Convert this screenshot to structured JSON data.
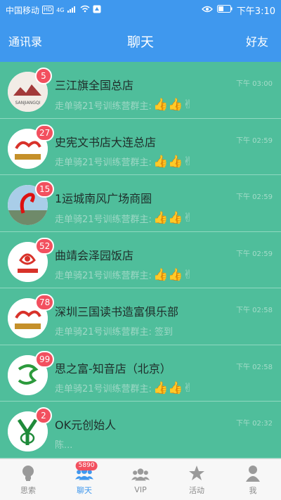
{
  "status": {
    "carrier": "中国移动",
    "hd": "HD",
    "network": "4G",
    "time": "下午3:10"
  },
  "nav": {
    "left": "通讯录",
    "title": "聊天",
    "right": "好友"
  },
  "chats": [
    {
      "name": "三江旗全国总店",
      "badge": "5",
      "time": "下午 03:00",
      "preview": "走单骑21号训练营群主:",
      "emoji": "👍👍✌"
    },
    {
      "name": "史宪文书店大连总店",
      "badge": "27",
      "time": "下午 02:59",
      "preview": "走单骑21号训练营群主:",
      "emoji": "👍👍✌"
    },
    {
      "name": "1运城南风广场商圈",
      "badge": "15",
      "time": "下午 02:59",
      "preview": "走单骑21号训练营群主:",
      "emoji": "👍👍✌"
    },
    {
      "name": "曲靖会泽园饭店",
      "badge": "52",
      "time": "下午 02:59",
      "preview": "走单骑21号训练营群主:",
      "emoji": "👍👍✌"
    },
    {
      "name": "深圳三国读书造富俱乐部",
      "badge": "78",
      "time": "下午 02:58",
      "preview": "走单骑21号训练营群主: 签到",
      "emoji": ""
    },
    {
      "name": "思之富-知音店（北京）",
      "badge": "99",
      "time": "下午 02:58",
      "preview": "走单骑21号训练营群主:",
      "emoji": "👍👍✌"
    },
    {
      "name": "OK元创始人",
      "badge": "2",
      "time": "下午 02:32",
      "preview": "陈...",
      "emoji": ""
    }
  ],
  "tabs": [
    {
      "label": "思索",
      "icon": "bulb-icon"
    },
    {
      "label": "聊天",
      "icon": "people-icon",
      "badge": "5890"
    },
    {
      "label": "VIP",
      "icon": "group-icon"
    },
    {
      "label": "活动",
      "icon": "star-icon"
    },
    {
      "label": "我",
      "icon": "person-icon"
    }
  ],
  "colors": {
    "header": "#3f98ee",
    "list_bg": "#4fbe9b",
    "badge": "#f2505f",
    "active_tab": "#3f98ee"
  }
}
